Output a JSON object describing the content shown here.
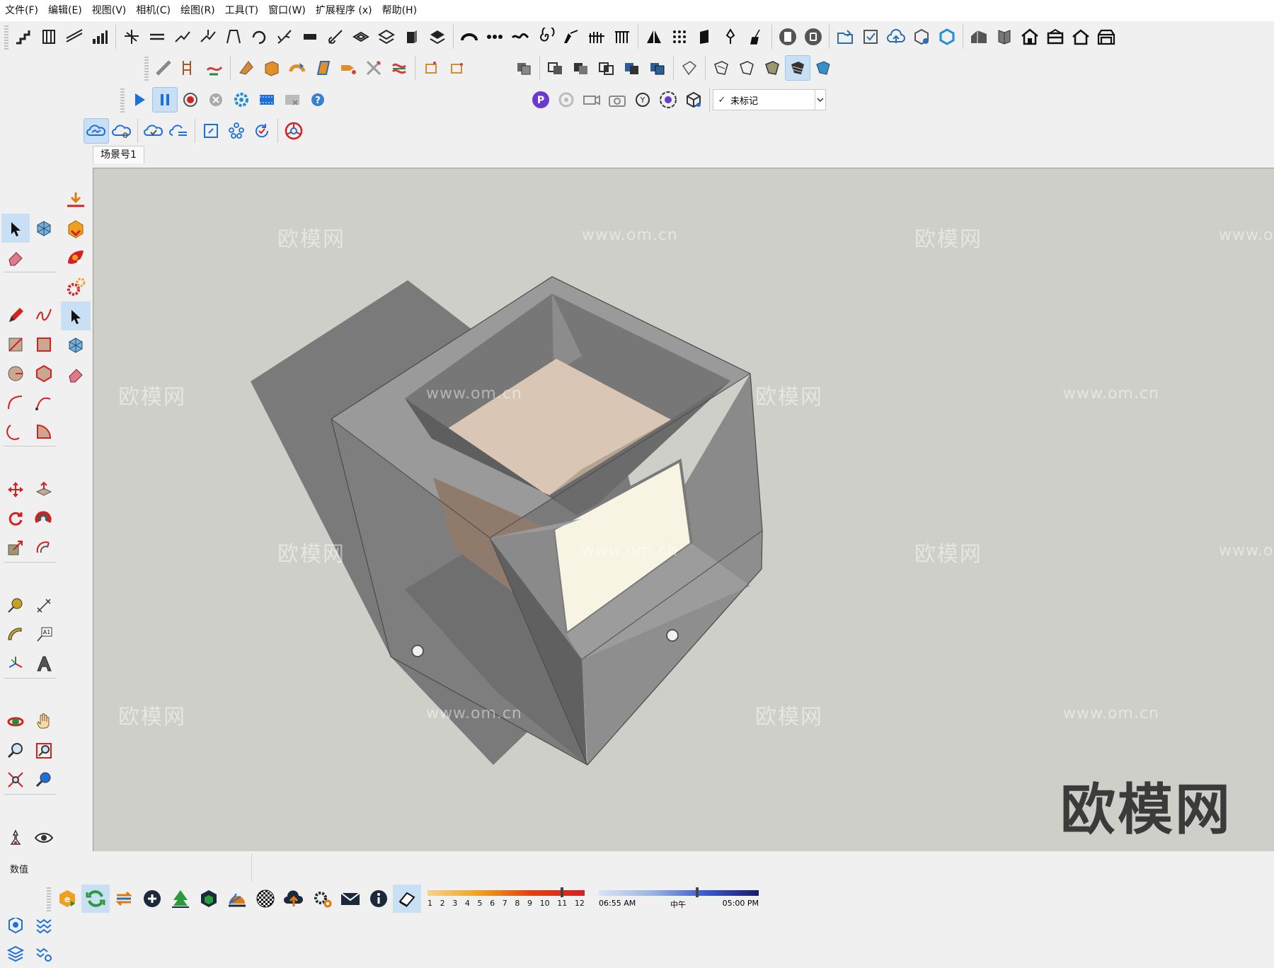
{
  "menu": [
    "文件(F)",
    "编辑(E)",
    "视图(V)",
    "相机(C)",
    "绘图(R)",
    "工具(T)",
    "窗口(W)",
    "扩展程序 (x)",
    "帮助(H)"
  ],
  "scene": {
    "tab_label": "场景号1"
  },
  "tag_combo": {
    "value": "未标记",
    "check": "✓"
  },
  "status": {
    "value_label": "数值"
  },
  "shadow": {
    "months": [
      "1",
      "2",
      "3",
      "4",
      "5",
      "6",
      "7",
      "8",
      "9",
      "10",
      "11",
      "12"
    ],
    "time_start": "06:55 AM",
    "time_noon": "中午",
    "time_end": "05:00 PM"
  },
  "watermark": {
    "brand": "欧模网",
    "url": "www.om.cn"
  },
  "colors": {
    "viewport_bg": "#cfcfca",
    "accent": "#1e6fd9",
    "model_gray": "#8e8e8e"
  }
}
